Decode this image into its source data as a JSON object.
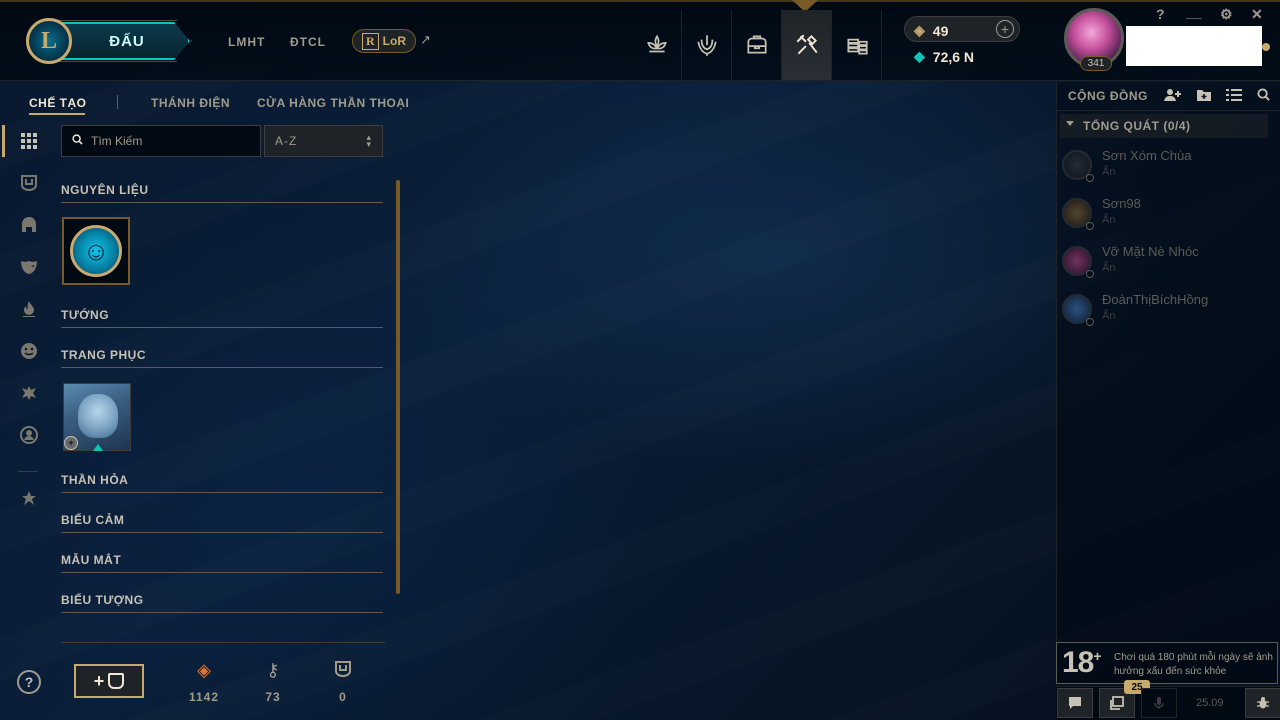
{
  "topbar": {
    "logo_letter": "L",
    "play_label": "ĐẤU",
    "nav": [
      "LMHT",
      "ĐTCL"
    ],
    "lor_label": "LoR",
    "external_icon": "external-link-icon",
    "rp": "49",
    "blue_essence": "72,6 N",
    "level": "341",
    "window_controls": [
      "?",
      "__",
      "⚙",
      "✕"
    ]
  },
  "subnav": {
    "items": [
      "CHẾ TẠO",
      "THÁNH ĐIỆN",
      "CỬA HÀNG THẦN THOẠI"
    ]
  },
  "filters": {
    "search_placeholder": "Tìm Kiếm",
    "sort_value": "A-Z"
  },
  "categories": {
    "materials": "NGUYÊN LIỆU",
    "champions": "TƯỚNG",
    "skins": "TRANG PHỤC",
    "wards": "THẦN HỎA",
    "emotes": "BIỂU CẢM",
    "eyes": "MẪU MẮT",
    "icons": "BIỂU TƯỢNG"
  },
  "counters": {
    "orange_essence": "1142",
    "keys": "73",
    "chests": "0"
  },
  "social": {
    "title": "CỘNG ĐỒNG",
    "group_label": "TỔNG QUÁT (0/4)",
    "friends": [
      {
        "name": "Sơn Xóm Chùa",
        "status": "Ẩn"
      },
      {
        "name": "Sơn98",
        "status": "Ẩn"
      },
      {
        "name": "Vỡ Mặt Nè Nhóc",
        "status": "Ẩn"
      },
      {
        "name": "ĐoànThịBíchHồng",
        "status": "Ẩn"
      }
    ]
  },
  "footer": {
    "age_rating": "18",
    "age_plus": "+",
    "warning": "Chơi quá 180 phút mỗi ngày sẽ ảnh hưởng xấu đến sức khỏe",
    "notification_count": "25",
    "patch": "25.09"
  },
  "colors": {
    "gold": "#c8aa6e",
    "teal": "#0ac8b9",
    "background": "#0a1428"
  }
}
